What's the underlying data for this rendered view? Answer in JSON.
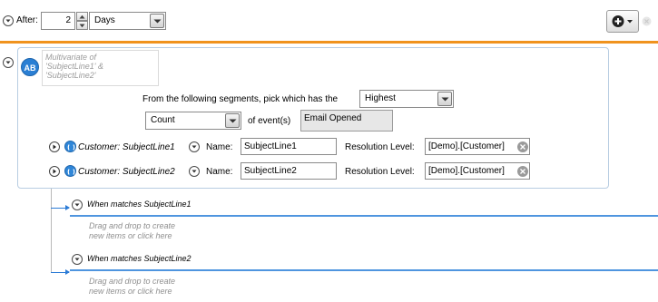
{
  "header": {
    "after_label": "After:",
    "after_value": "2",
    "unit_value": "Days"
  },
  "panel": {
    "description": [
      "Multivariate of",
      "'SubjectLine1' &",
      "'SubjectLine2'"
    ],
    "ab_icon_text": "AB",
    "pick_text": "From the following segments, pick which has the",
    "pick_value": "Highest",
    "metric_value": "Count",
    "events_label": "of event(s)",
    "event_name": "Email Opened"
  },
  "segments": [
    {
      "label": "Customer: SubjectLine1",
      "name_label": "Name:",
      "name_value": "SubjectLine1",
      "resolution_label": "Resolution Level:",
      "resolution_value": "[Demo].[Customer]"
    },
    {
      "label": "Customer: SubjectLine2",
      "name_label": "Name:",
      "name_value": "SubjectLine2",
      "resolution_label": "Resolution Level:",
      "resolution_value": "[Demo].[Customer]"
    }
  ],
  "branches": [
    {
      "title": "When matches SubjectLine1",
      "hint": [
        "Drag and drop to create",
        "new items or click here"
      ]
    },
    {
      "title": "When matches SubjectLine2",
      "hint": [
        "Drag and drop to create",
        "new items or click here"
      ]
    }
  ],
  "colors": {
    "accent_orange": "#f0931e",
    "accent_blue": "#2b7bd6",
    "panel_border": "#b8cde2"
  }
}
